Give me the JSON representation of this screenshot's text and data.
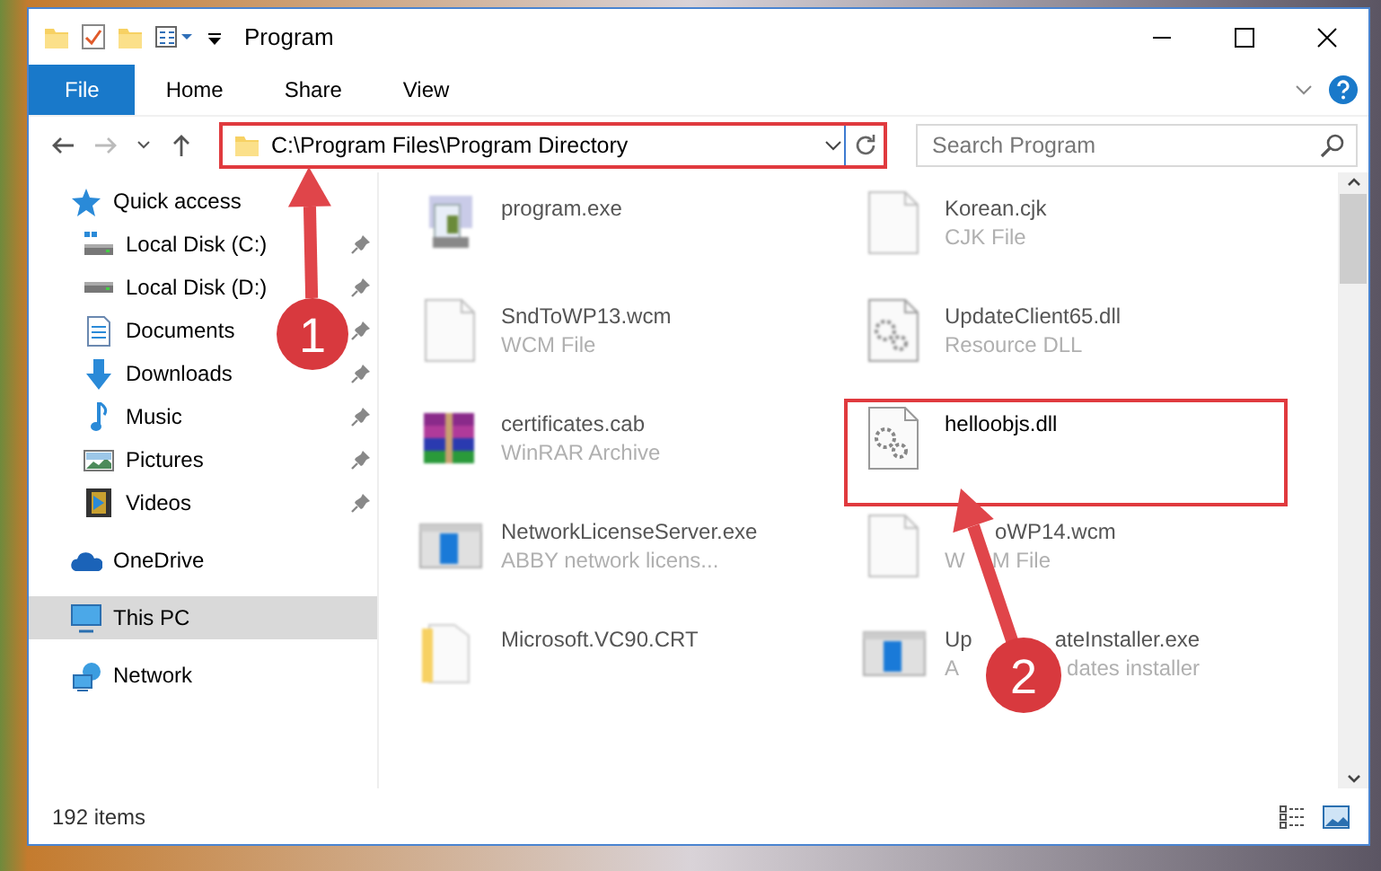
{
  "window": {
    "title": "Program"
  },
  "ribbon_tabs": [
    {
      "label": "File",
      "selected": true
    },
    {
      "label": "Home",
      "selected": false
    },
    {
      "label": "Share",
      "selected": false
    },
    {
      "label": "View",
      "selected": false
    }
  ],
  "address": {
    "path": "C:\\Program Files\\Program Directory",
    "highlighted": true
  },
  "search": {
    "placeholder": "Search Program"
  },
  "sidebar": {
    "items": [
      {
        "label": "Quick access",
        "kind": "star",
        "selected": false,
        "children": [
          {
            "label": "Local Disk (C:)",
            "kind": "disk-c",
            "pinned": true,
            "selected": false
          },
          {
            "label": "Local Disk (D:)",
            "kind": "disk",
            "pinned": true,
            "selected": false
          },
          {
            "label": "Documents",
            "kind": "docs",
            "pinned": true,
            "selected": false
          },
          {
            "label": "Downloads",
            "kind": "download",
            "pinned": true,
            "selected": false
          },
          {
            "label": "Music",
            "kind": "music",
            "pinned": true,
            "selected": false
          },
          {
            "label": "Pictures",
            "kind": "pictures",
            "pinned": true,
            "selected": false
          },
          {
            "label": "Videos",
            "kind": "videos",
            "pinned": true,
            "selected": false
          }
        ]
      },
      {
        "label": "OneDrive",
        "kind": "cloud",
        "selected": false
      },
      {
        "label": "This PC",
        "kind": "pc",
        "selected": true
      },
      {
        "label": "Network",
        "kind": "network",
        "selected": false
      }
    ]
  },
  "files": [
    {
      "name": [
        "program.exe"
      ],
      "kind": "exe",
      "blurred": true,
      "highlighted": false
    },
    {
      "name": [
        "Korean.cjk"
      ],
      "type": [
        "CJK File"
      ],
      "kind": "blank",
      "blurred": true,
      "highlighted": false
    },
    {
      "name": [
        "SndToWP13.wcm"
      ],
      "type": [
        "WCM File"
      ],
      "kind": "blank",
      "blurred": true,
      "highlighted": false
    },
    {
      "name": [
        "UpdateClient65.dll"
      ],
      "type": [
        "Resource DLL"
      ],
      "kind": "dll",
      "blurred": true,
      "highlighted": false
    },
    {
      "name": [
        "certificates.cab"
      ],
      "type": [
        "WinRAR Archive"
      ],
      "kind": "archive",
      "blurred": true,
      "highlighted": false
    },
    {
      "name": [
        "helloobjs.dll"
      ],
      "kind": "dll",
      "blurred": false,
      "highlighted": true
    },
    {
      "name": [
        "NetworkLicenseServer.exe"
      ],
      "type": [
        "ABBY network licens..."
      ],
      "kind": "app",
      "blurred": true,
      "highlighted": false
    },
    {
      "name": [
        "oWP14.wcm"
      ],
      "type": [
        "W",
        "M File"
      ],
      "kind": "blank",
      "blurred": true,
      "highlighted": false
    },
    {
      "name": [
        "Microsoft.VC90.CRT"
      ],
      "kind": "folder",
      "blurred": true,
      "highlighted": false
    },
    {
      "name": [
        "Up",
        "ateInstaller.exe"
      ],
      "type": [
        "A",
        "dates installer"
      ],
      "kind": "app",
      "blurred": true,
      "highlighted": false
    }
  ],
  "status_bar": {
    "count": "192 items"
  },
  "callouts": [
    {
      "number": "1"
    },
    {
      "number": "2"
    }
  ]
}
